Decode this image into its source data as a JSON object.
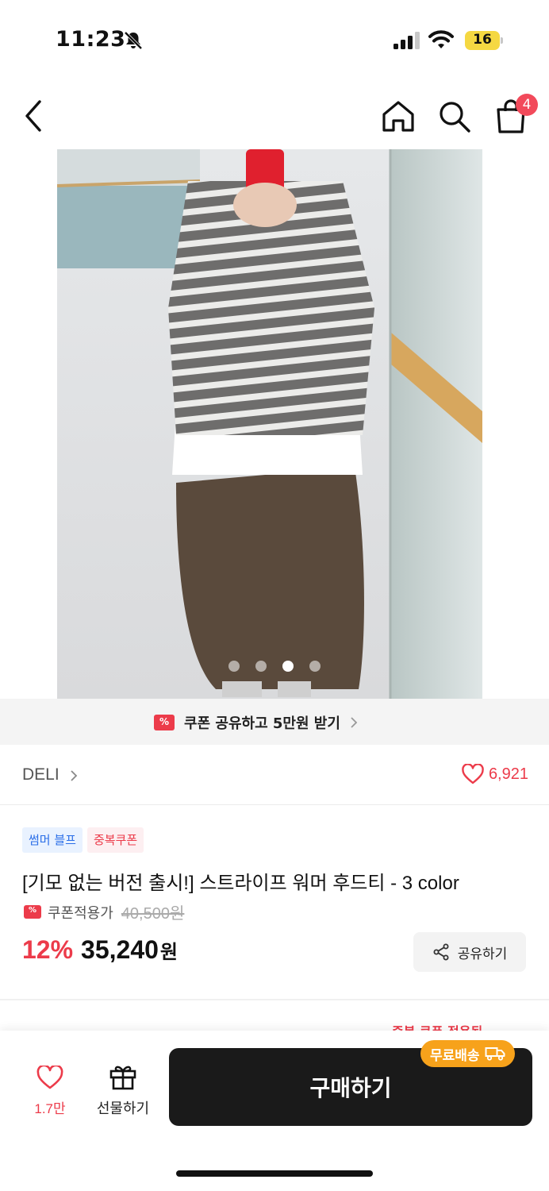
{
  "status_bar": {
    "time": "11:23",
    "battery_level": "16",
    "icons": [
      "bell-slash-icon",
      "signal-icon",
      "wifi-icon",
      "battery-icon"
    ]
  },
  "nav": {
    "cart_count": "4",
    "icons": [
      "back-icon",
      "home-icon",
      "search-icon",
      "shopping-bag-icon"
    ]
  },
  "gallery": {
    "total_images": 4,
    "active_index": 2
  },
  "coupon_banner": {
    "text": "쿠폰 공유하고 5만원 받기"
  },
  "brand": {
    "name": "DELI",
    "likes": "6,921"
  },
  "product": {
    "badges": [
      "썸머 블프",
      "중복쿠폰"
    ],
    "title": "[기모 없는 버전 출시!] 스트라이프 워머 후드티 - 3 color",
    "coupon_apply_label": "쿠폰적용가",
    "original_price": "40,500원",
    "discount": "12%",
    "price": "35,240",
    "price_unit": "원",
    "share_label": "공유하기",
    "peek_text": "중복 쿠폰 적용됨"
  },
  "bottom_bar": {
    "wish_count": "1.7만",
    "gift_label": "선물하기",
    "buy_label": "구매하기",
    "free_shipping": "무료배송"
  },
  "colors": {
    "accent_red": "#ec3b4a",
    "buy_button": "#1a1a1a",
    "free_shipping": "#f7a21b",
    "badge_blue": "#2a6ee8",
    "battery": "#f5d842"
  }
}
